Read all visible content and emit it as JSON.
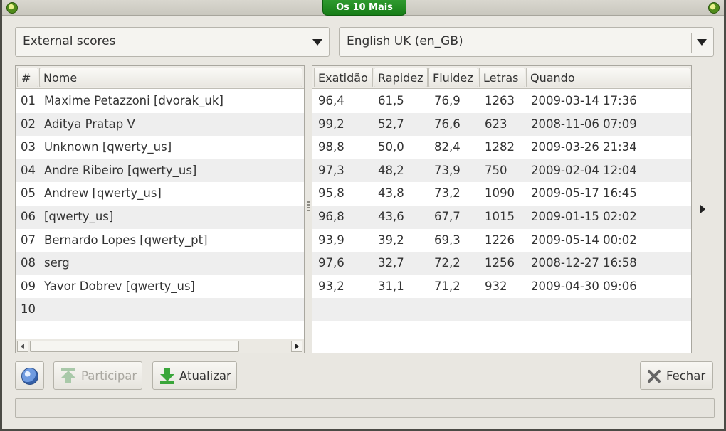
{
  "window": {
    "title": "Os 10 Mais"
  },
  "source_combo": {
    "value": "External scores"
  },
  "language_combo": {
    "value": "English UK (en_GB)"
  },
  "names_table": {
    "headers": [
      "#",
      "Nome"
    ],
    "rows": [
      [
        "01",
        "Maxime Petazzoni [dvorak_uk]"
      ],
      [
        "02",
        "Aditya Pratap V"
      ],
      [
        "03",
        "Unknown [qwerty_us]"
      ],
      [
        "04",
        "Andre Ribeiro [qwerty_us]"
      ],
      [
        "05",
        "Andrew [qwerty_us]"
      ],
      [
        "06",
        "[qwerty_us]"
      ],
      [
        "07",
        "Bernardo Lopes [qwerty_pt]"
      ],
      [
        "08",
        "serg"
      ],
      [
        "09",
        "Yavor Dobrev [qwerty_us]"
      ],
      [
        "10",
        ""
      ]
    ]
  },
  "scores_table": {
    "headers": [
      "Exatidão",
      "Rapidez",
      "Fluidez",
      "Letras",
      "Quando"
    ],
    "rows": [
      [
        "96,4",
        "61,5",
        "76,9",
        "1263",
        "2009-03-14 17:36"
      ],
      [
        "99,2",
        "52,7",
        "76,6",
        "623",
        "2008-11-06 07:09"
      ],
      [
        "98,8",
        "50,0",
        "82,4",
        "1282",
        "2009-03-26 21:34"
      ],
      [
        "97,3",
        "48,2",
        "73,9",
        "750",
        "2009-02-04 12:04"
      ],
      [
        "95,8",
        "43,8",
        "73,2",
        "1090",
        "2009-05-17 16:45"
      ],
      [
        "96,8",
        "43,6",
        "67,7",
        "1015",
        "2009-01-15 02:02"
      ],
      [
        "93,9",
        "39,2",
        "69,3",
        "1226",
        "2009-05-14 00:02"
      ],
      [
        "97,6",
        "32,7",
        "72,2",
        "1256",
        "2008-12-27 16:58"
      ],
      [
        "93,2",
        "31,1",
        "71,2",
        "932",
        "2009-04-30 09:06"
      ],
      [
        "",
        "",
        "",
        "",
        ""
      ]
    ]
  },
  "buttons": {
    "participate": "Participar",
    "update": "Atualizar",
    "close": "Fechar"
  },
  "icons": {
    "web": "globe-icon",
    "participate": "upload-icon",
    "update": "download-icon",
    "close": "close-icon"
  },
  "colors": {
    "title_tab": "#177d17",
    "row_alt": "#eeeeee",
    "icon_green": "#3aa63a"
  }
}
